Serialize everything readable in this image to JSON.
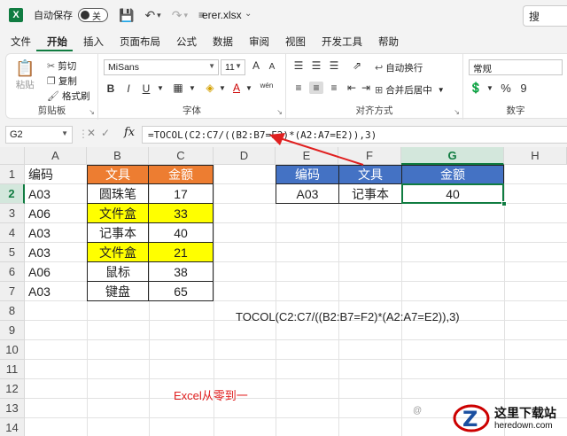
{
  "titlebar": {
    "app_icon": "X",
    "autosave_label": "自动保存",
    "autosave_state": "关",
    "filename": "erer.xlsx",
    "search_placeholder": "搜"
  },
  "menu": [
    "文件",
    "开始",
    "插入",
    "页面布局",
    "公式",
    "数据",
    "审阅",
    "视图",
    "开发工具",
    "帮助"
  ],
  "menu_active": "开始",
  "ribbon": {
    "clipboard": {
      "label": "剪贴板",
      "paste": "粘贴",
      "cut": "剪切",
      "copy": "复制",
      "format_painter": "格式刷"
    },
    "font": {
      "label": "字体",
      "font_name": "MiSans",
      "font_size": "11",
      "bold": "B",
      "italic": "I",
      "underline": "U",
      "grow": "A",
      "shrink": "A",
      "wen": "wén"
    },
    "alignment": {
      "label": "对齐方式",
      "wrap": "自动换行",
      "merge": "合并后居中"
    },
    "number": {
      "label": "数字",
      "format": "常规",
      "percent": "%",
      "comma": "9"
    }
  },
  "formula_bar": {
    "name_box": "G2",
    "fx": "fx",
    "formula": "=TOCOL(C2:C7/((B2:B7=F2)*(A2:A7=E2)),3)"
  },
  "columns": [
    "A",
    "B",
    "C",
    "D",
    "E",
    "F",
    "G",
    "H"
  ],
  "rows": [
    "1",
    "2",
    "3",
    "4",
    "5",
    "6",
    "7",
    "8",
    "9",
    "10",
    "11",
    "12",
    "13",
    "14"
  ],
  "selected_column": "G",
  "selected_row": "2",
  "cells": {
    "A1": "编码",
    "A2": "A03",
    "A3": "A06",
    "A4": "A03",
    "A5": "A03",
    "A6": "A06",
    "A7": "A03",
    "B1": "文具",
    "B2": "圆珠笔",
    "B3": "文件盒",
    "B4": "记事本",
    "B5": "文件盒",
    "B6": "鼠标",
    "B7": "键盘",
    "C1": "金额",
    "C2": "17",
    "C3": "33",
    "C4": "40",
    "C5": "21",
    "C6": "38",
    "C7": "65",
    "E1": "编码",
    "F1": "文具",
    "G1": "金额",
    "E2": "A03",
    "F2": "记事本",
    "G2": "40"
  },
  "annotations": {
    "formula_note": "TOCOL(C2:C7/((B2:B7=F2)*(A2:A7=E2)),3)",
    "brand_note": "Excel从零到一",
    "watermark_small": "@",
    "watermark_title": "这里下载站",
    "watermark_domain": "heredown.com"
  },
  "colors": {
    "excel_green": "#107c41",
    "header_orange": "#ed7d31",
    "highlight_yellow": "#ffff00",
    "header_blue": "#4472c4",
    "annotation_red": "#e02020"
  }
}
